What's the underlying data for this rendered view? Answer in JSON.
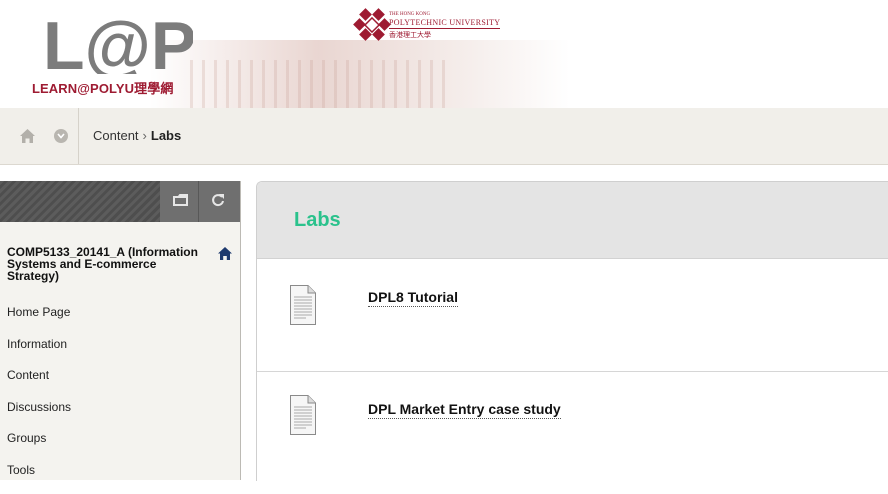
{
  "header": {
    "logo_mark": "L@PU",
    "logo_text": "LEARN@POLYU理學網",
    "university_line1": "THE HONG KONG",
    "university_line2": "POLYTECHNIC UNIVERSITY",
    "university_line3": "香港理工大學",
    "brand_color": "#9e1b32"
  },
  "breadcrumb": {
    "home_icon": "home-icon",
    "menu_icon": "chevron-down-circle-icon",
    "parent": "Content",
    "separator": "›",
    "current": "Labs"
  },
  "course_menu": {
    "toolbar_icons": [
      "folder-icon",
      "refresh-icon"
    ],
    "course_title": "COMP5133_20141_A (Information Systems and E-commerce Strategy)",
    "items": [
      {
        "label": "Home Page"
      },
      {
        "label": "Information"
      },
      {
        "label": "Content"
      },
      {
        "label": "Discussions"
      },
      {
        "label": "Groups"
      },
      {
        "label": "Tools"
      }
    ]
  },
  "content": {
    "title": "Labs",
    "title_color": "#2ac28c",
    "items": [
      {
        "label": "DPL8 Tutorial",
        "icon": "document-icon"
      },
      {
        "label": "DPL Market Entry case study",
        "icon": "document-icon"
      }
    ]
  }
}
